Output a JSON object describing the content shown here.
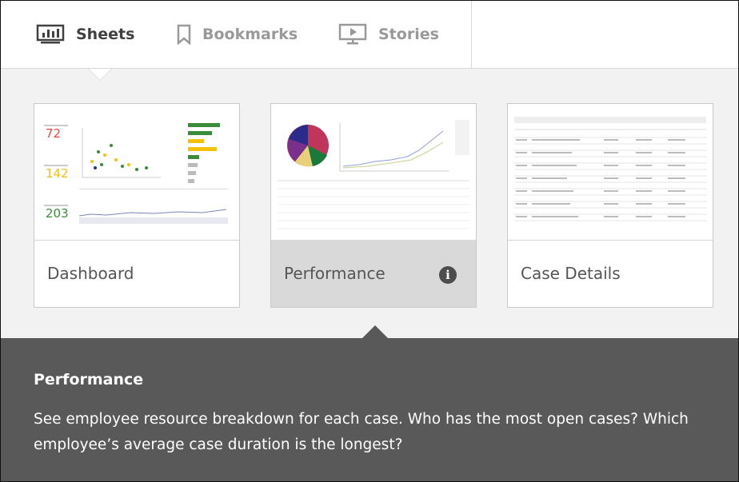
{
  "tabs": [
    {
      "label": "Sheets",
      "icon": "sheets-icon",
      "active": true
    },
    {
      "label": "Bookmarks",
      "icon": "bookmark-icon",
      "active": false
    },
    {
      "label": "Stories",
      "icon": "stories-icon",
      "active": false
    }
  ],
  "sheets": [
    {
      "title": "Dashboard",
      "kpis": [
        "72",
        "142",
        "203"
      ]
    },
    {
      "title": "Performance",
      "selected": true
    },
    {
      "title": "Case Details"
    }
  ],
  "description": {
    "title": "Performance",
    "line1": "See employee resource breakdown for each case. Who has the most open cases? Which",
    "line2": "employee’s average case duration is the longest?"
  },
  "colors": {
    "panel": "#595959",
    "kpi_red": "#e8484a",
    "kpi_yellow": "#f5c10f",
    "kpi_green": "#3a8c3a"
  }
}
